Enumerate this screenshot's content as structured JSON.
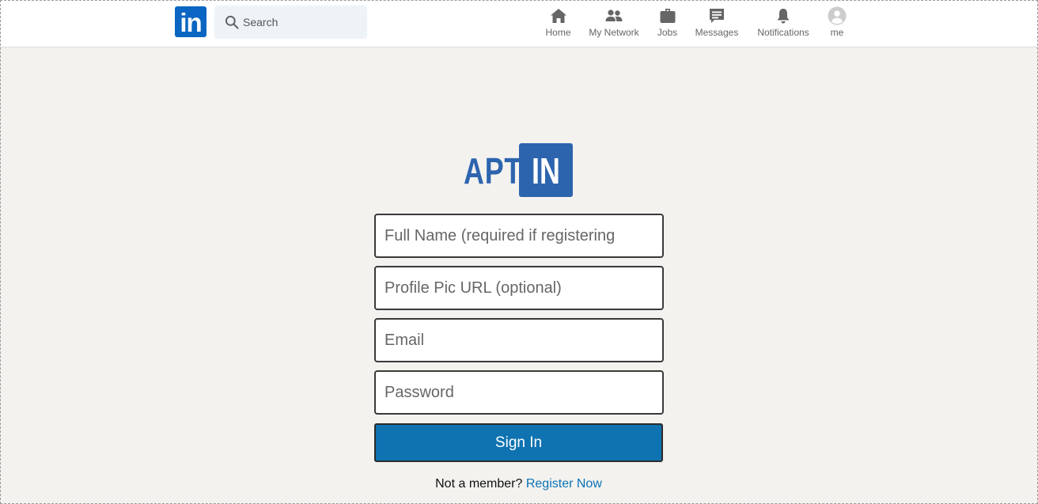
{
  "navbar": {
    "logo_text": "in",
    "search": {
      "placeholder": "Search"
    },
    "items": [
      {
        "label": "Home",
        "icon": "home-icon"
      },
      {
        "label": "My Network",
        "icon": "people-icon"
      },
      {
        "label": "Jobs",
        "icon": "briefcase-icon"
      },
      {
        "label": "Messages",
        "icon": "message-icon"
      },
      {
        "label": "Notifications",
        "icon": "bell-icon"
      },
      {
        "label": "me",
        "icon": "avatar-icon"
      }
    ]
  },
  "brand": {
    "left": "APT",
    "right": "IN"
  },
  "form": {
    "full_name_placeholder": "Full Name (required if registering",
    "profile_pic_placeholder": "Profile Pic URL (optional)",
    "email_placeholder": "Email",
    "password_placeholder": "Password",
    "signin_label": "Sign In",
    "register_prompt": "Not a member?",
    "register_link": "Register Now"
  },
  "colors": {
    "brand_blue": "#2d64ae",
    "linkedin_blue": "#0a66c2",
    "button_blue": "#0f73b1",
    "page_background": "#f3f2ef"
  }
}
